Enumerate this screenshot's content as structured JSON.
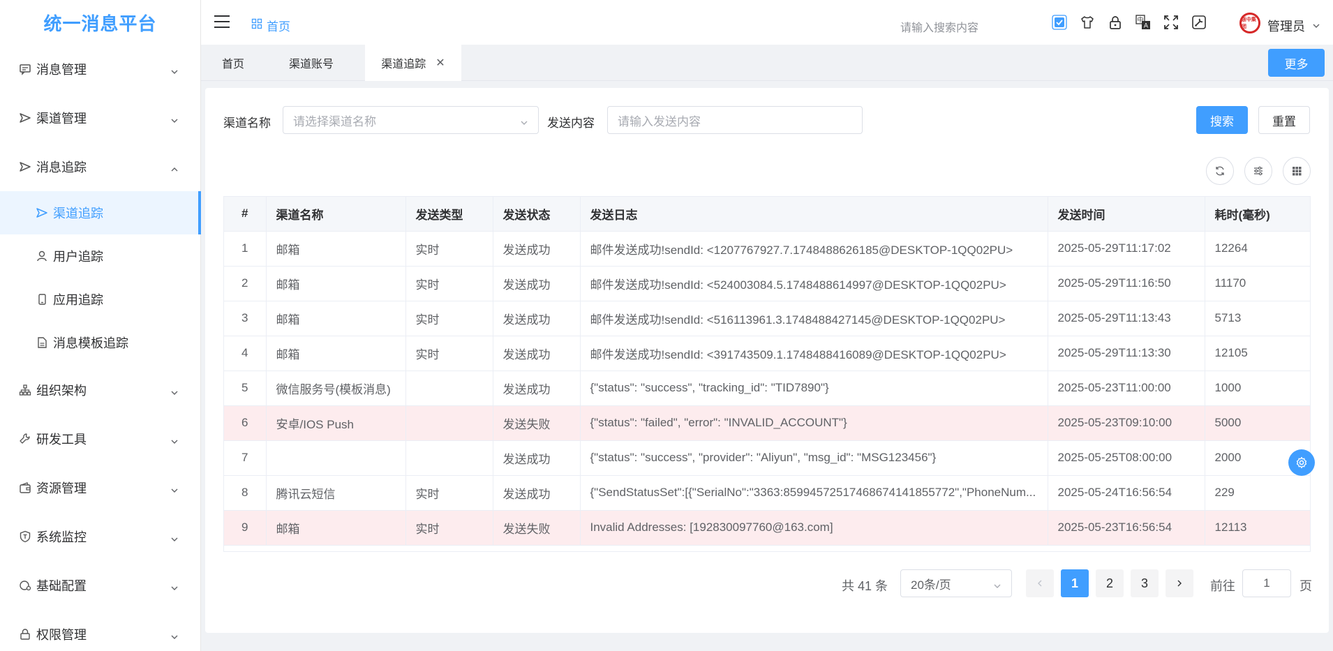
{
  "app": {
    "title": "统一消息平台"
  },
  "sidebar": {
    "items": [
      {
        "label": "消息管理",
        "icon": "message-icon"
      },
      {
        "label": "渠道管理",
        "icon": "send-icon"
      },
      {
        "label": "消息追踪",
        "icon": "send-icon"
      },
      {
        "label": "组织架构",
        "icon": "org-icon"
      },
      {
        "label": "研发工具",
        "icon": "tool-icon"
      },
      {
        "label": "资源管理",
        "icon": "wallet-icon"
      },
      {
        "label": "系统监控",
        "icon": "shield-icon"
      },
      {
        "label": "基础配置",
        "icon": "config-icon"
      },
      {
        "label": "权限管理",
        "icon": "lock-icon"
      }
    ],
    "subitems": [
      {
        "label": "渠道追踪",
        "icon": "send-icon",
        "active": true
      },
      {
        "label": "用户追踪",
        "icon": "user-icon"
      },
      {
        "label": "应用追踪",
        "icon": "phone-icon"
      },
      {
        "label": "消息模板追踪",
        "icon": "document-icon"
      }
    ]
  },
  "header": {
    "breadcrumb": "首页",
    "search_placeholder": "请输入搜索内容",
    "username": "管理员",
    "avatar_text": "浙中集团"
  },
  "tabs": {
    "items": [
      "首页",
      "渠道账号",
      "渠道追踪"
    ],
    "active": "渠道追踪",
    "more_label": "更多"
  },
  "filters": {
    "channel_label": "渠道名称",
    "channel_placeholder": "请选择渠道名称",
    "content_label": "发送内容",
    "content_placeholder": "请输入发送内容",
    "search_label": "搜索",
    "reset_label": "重置"
  },
  "table": {
    "columns": [
      "#",
      "渠道名称",
      "发送类型",
      "发送状态",
      "发送日志",
      "发送时间",
      "耗时(毫秒)"
    ],
    "rows": [
      [
        "1",
        "邮箱",
        "实时",
        "发送成功",
        "邮件发送成功!sendId: <1207767927.7.1748488626185@DESKTOP-1QQ02PU>",
        "2025-05-29T11:17:02",
        "12264"
      ],
      [
        "2",
        "邮箱",
        "实时",
        "发送成功",
        "邮件发送成功!sendId: <524003084.5.1748488614997@DESKTOP-1QQ02PU>",
        "2025-05-29T11:16:50",
        "11170"
      ],
      [
        "3",
        "邮箱",
        "实时",
        "发送成功",
        "邮件发送成功!sendId: <516113961.3.1748488427145@DESKTOP-1QQ02PU>",
        "2025-05-29T11:13:43",
        "5713"
      ],
      [
        "4",
        "邮箱",
        "实时",
        "发送成功",
        "邮件发送成功!sendId: <391743509.1.1748488416089@DESKTOP-1QQ02PU>",
        "2025-05-29T11:13:30",
        "12105"
      ],
      [
        "5",
        "微信服务号(模板消息)",
        "",
        "发送成功",
        "{\"status\": \"success\", \"tracking_id\": \"TID7890\"}",
        "2025-05-23T11:00:00",
        "1000"
      ],
      [
        "6",
        "安卓/IOS Push",
        "",
        "发送失败",
        "{\"status\": \"failed\", \"error\": \"INVALID_ACCOUNT\"}",
        "2025-05-23T09:10:00",
        "5000"
      ],
      [
        "7",
        "",
        "",
        "发送成功",
        "{\"status\": \"success\", \"provider\": \"Aliyun\", \"msg_id\": \"MSG123456\"}",
        "2025-05-25T08:00:00",
        "2000"
      ],
      [
        "8",
        "腾讯云短信",
        "实时",
        "发送成功",
        "{\"SendStatusSet\":[{\"SerialNo\":\"3363:85994572517468674141855772\",\"PhoneNum...",
        "2025-05-24T16:56:54",
        "229"
      ],
      [
        "9",
        "邮箱",
        "实时",
        "发送失败",
        "Invalid Addresses: [192830097760@163.com]",
        "2025-05-23T16:56:54",
        "12113"
      ]
    ],
    "failed_rows": [
      6,
      9
    ]
  },
  "pagination": {
    "total": "共 41 条",
    "page_size": "20条/页",
    "pages": [
      "1",
      "2",
      "3"
    ],
    "current": "1",
    "goto_label": "前往",
    "goto_value": "1",
    "page_suffix": "页"
  },
  "colors": {
    "primary": "#409eff",
    "fail_row": "#fdecee"
  }
}
